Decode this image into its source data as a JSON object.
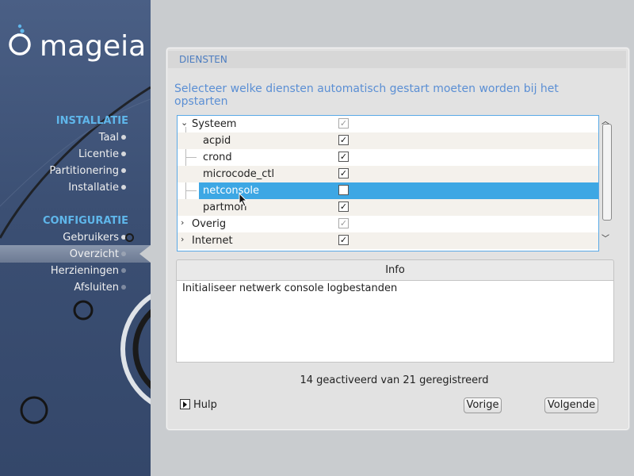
{
  "sidebar": {
    "logo_text": "mageia",
    "sections": [
      {
        "title": "INSTALLATIE",
        "items": [
          "Taal",
          "Licentie",
          "Partitionering",
          "Installatie"
        ]
      },
      {
        "title": "CONFIGURATIE",
        "items": [
          "Gebruikers",
          "Overzicht",
          "Herzieningen",
          "Afsluiten"
        ]
      }
    ],
    "active_item": "Overzicht"
  },
  "panel": {
    "title": "DIENSTEN",
    "instruction": "Selecteer welke diensten automatisch gestart moeten worden bij het opstarten"
  },
  "tree": {
    "rows": [
      {
        "label": "Systeem",
        "expander": "⌄",
        "checked": true,
        "dim": true
      },
      {
        "label": "acpid",
        "checked": true
      },
      {
        "label": "crond",
        "checked": true
      },
      {
        "label": "microcode_ctl",
        "checked": true
      },
      {
        "label": "netconsole",
        "checked": false,
        "selected": true
      },
      {
        "label": "partmon",
        "checked": true
      },
      {
        "label": "Overig",
        "expander": "›",
        "checked": true,
        "dim": true
      },
      {
        "label": "Internet",
        "expander": "›",
        "checked": true
      }
    ]
  },
  "info": {
    "header": "Info",
    "text": "Initialiseer netwerk console logbestanden"
  },
  "status": "14 geactiveerd van 21 geregistreerd",
  "buttons": {
    "help": "Hulp",
    "previous": "Vorige",
    "next": "Volgende"
  },
  "colors": {
    "sidebar_bg": "#3f5378",
    "section_title": "#5fb6ea",
    "selection": "#3da7e4",
    "heading_blue": "#5b8fd4"
  }
}
